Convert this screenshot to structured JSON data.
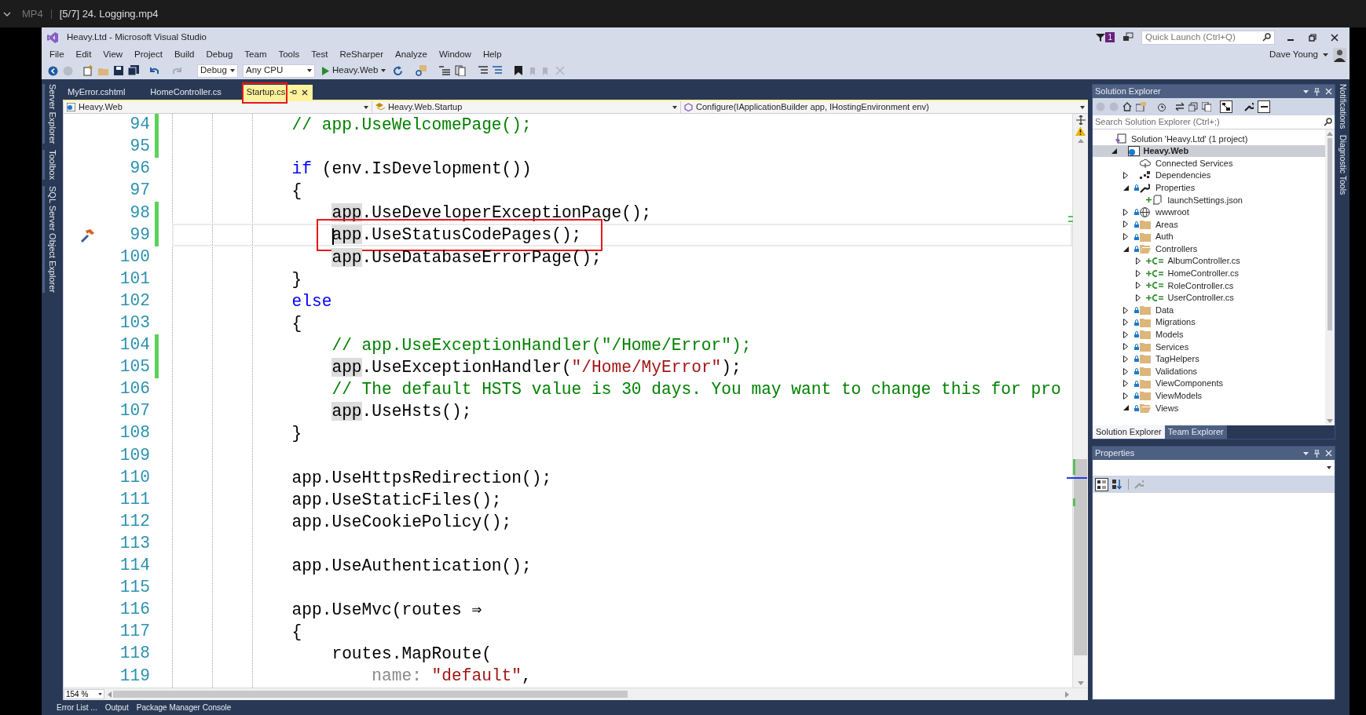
{
  "player": {
    "format": "MP4",
    "title": "[5/7] 24. Logging.mp4"
  },
  "window": {
    "title": "Heavy.Ltd - Microsoft Visual Studio",
    "notification_count": "1",
    "quick_launch_placeholder": "Quick Launch (Ctrl+Q)",
    "user": "Dave Young"
  },
  "menu": [
    "File",
    "Edit",
    "View",
    "Project",
    "Build",
    "Debug",
    "Team",
    "Tools",
    "Test",
    "ReSharper",
    "Analyze",
    "Window",
    "Help"
  ],
  "toolbar": {
    "configuration": "Debug",
    "platform": "Any CPU",
    "start": "Heavy.Web"
  },
  "left_tool_tabs": [
    "Server Explorer",
    "Toolbox",
    "SQL Server Object Explorer"
  ],
  "right_tool_tabs": [
    "Notifications",
    "Diagnostic Tools"
  ],
  "document_tabs": [
    {
      "label": "MyError.cshtml",
      "selected": false,
      "annotated": false
    },
    {
      "label": "HomeController.cs",
      "selected": false,
      "annotated": false
    },
    {
      "label": "Startup.cs",
      "selected": true,
      "annotated": true
    }
  ],
  "navigation": {
    "project": "Heavy.Web",
    "type": "Heavy.Web.Startup",
    "member": "Configure(IApplicationBuilder app, IHostingEnvironment env)"
  },
  "code_lines": [
    {
      "number": "94",
      "changed": true,
      "current": false,
      "annotated": false,
      "tokens": [
        {
          "kind": "comment",
          "text": "            // app.UseWelcomePage();"
        }
      ]
    },
    {
      "number": "95",
      "changed": true,
      "current": false,
      "annotated": false
    },
    {
      "number": "96",
      "changed": false,
      "current": false,
      "annotated": false,
      "tokens": [
        {
          "kind": "keyword",
          "text": "            if"
        },
        {
          "kind": "plain",
          "text": " (env.IsDevelopment())"
        }
      ]
    },
    {
      "number": "97",
      "changed": false,
      "current": false,
      "annotated": false,
      "tokens": [
        {
          "kind": "plain",
          "text": "            {"
        }
      ]
    },
    {
      "number": "98",
      "changed": true,
      "current": false,
      "annotated": false,
      "tokens": [
        {
          "kind": "reference",
          "text": "                app"
        },
        {
          "kind": "plain",
          "text": ".UseDeveloperExceptionPage();"
        }
      ]
    },
    {
      "number": "99",
      "changed": true,
      "current": true,
      "annotated": true,
      "tokens": [
        {
          "kind": "reference",
          "text": "                app"
        },
        {
          "kind": "plain",
          "text": ".UseStatusCodePages();"
        }
      ]
    },
    {
      "number": "100",
      "changed": false,
      "current": false,
      "annotated": false,
      "tokens": [
        {
          "kind": "reference",
          "text": "                app"
        },
        {
          "kind": "plain",
          "text": ".UseDatabaseErrorPage();"
        }
      ]
    },
    {
      "number": "101",
      "changed": false,
      "current": false,
      "annotated": false,
      "tokens": [
        {
          "kind": "plain",
          "text": "            }"
        }
      ]
    },
    {
      "number": "102",
      "changed": false,
      "current": false,
      "annotated": false,
      "tokens": [
        {
          "kind": "keyword",
          "text": "            else"
        }
      ]
    },
    {
      "number": "103",
      "changed": false,
      "current": false,
      "annotated": false,
      "tokens": [
        {
          "kind": "plain",
          "text": "            {"
        }
      ]
    },
    {
      "number": "104",
      "changed": true,
      "current": false,
      "annotated": false,
      "tokens": [
        {
          "kind": "comment",
          "text": "                // app.UseExceptionHandler(\"/Home/Error\");"
        }
      ]
    },
    {
      "number": "105",
      "changed": true,
      "current": false,
      "annotated": false,
      "tokens": [
        {
          "kind": "reference",
          "text": "                app"
        },
        {
          "kind": "plain",
          "text": ".UseExceptionHandler("
        },
        {
          "kind": "string",
          "text": "\"/Home/MyError\""
        },
        {
          "kind": "plain",
          "text": ");"
        }
      ]
    },
    {
      "number": "106",
      "changed": false,
      "current": false,
      "annotated": false,
      "tokens": [
        {
          "kind": "comment",
          "text": "                // The default HSTS value is 30 days. You may want to change this for pro"
        }
      ]
    },
    {
      "number": "107",
      "changed": false,
      "current": false,
      "annotated": false,
      "tokens": [
        {
          "kind": "reference",
          "text": "                app"
        },
        {
          "kind": "plain",
          "text": ".UseHsts();"
        }
      ]
    },
    {
      "number": "108",
      "changed": false,
      "current": false,
      "annotated": false,
      "tokens": [
        {
          "kind": "plain",
          "text": "            }"
        }
      ]
    },
    {
      "number": "109",
      "changed": false,
      "current": false,
      "annotated": false
    },
    {
      "number": "110",
      "changed": false,
      "current": false,
      "annotated": false,
      "tokens": [
        {
          "kind": "plain",
          "text": "            app.UseHttpsRedirection();"
        }
      ]
    },
    {
      "number": "111",
      "changed": false,
      "current": false,
      "annotated": false,
      "tokens": [
        {
          "kind": "plain",
          "text": "            app.UseStaticFiles();"
        }
      ]
    },
    {
      "number": "112",
      "changed": false,
      "current": false,
      "annotated": false,
      "tokens": [
        {
          "kind": "plain",
          "text": "            app.UseCookiePolicy();"
        }
      ]
    },
    {
      "number": "113",
      "changed": false,
      "current": false,
      "annotated": false
    },
    {
      "number": "114",
      "changed": false,
      "current": false,
      "annotated": false,
      "tokens": [
        {
          "kind": "plain",
          "text": "            app.UseAuthentication();"
        }
      ]
    },
    {
      "number": "115",
      "changed": false,
      "current": false,
      "annotated": false
    },
    {
      "number": "116",
      "changed": false,
      "current": false,
      "annotated": false,
      "tokens": [
        {
          "kind": "plain",
          "text": "            app.UseMvc(routes ⇒"
        }
      ]
    },
    {
      "number": "117",
      "changed": false,
      "current": false,
      "annotated": false,
      "tokens": [
        {
          "kind": "plain",
          "text": "            {"
        }
      ]
    },
    {
      "number": "118",
      "changed": false,
      "current": false,
      "annotated": false,
      "tokens": [
        {
          "kind": "plain",
          "text": "                routes.MapRoute("
        }
      ]
    },
    {
      "number": "119",
      "changed": false,
      "current": false,
      "annotated": false,
      "tokens": [
        {
          "kind": "hint",
          "text": "                    name:"
        },
        {
          "kind": "string",
          "text": " \"default\""
        },
        {
          "kind": "plain",
          "text": ","
        }
      ]
    }
  ],
  "zoom": "154 %",
  "solution_explorer": {
    "title": "Solution Explorer",
    "search_placeholder": "Search Solution Explorer (Ctrl+;)",
    "tree": [
      {
        "label": "Solution 'Heavy.Ltd' (1 project)",
        "kind": "solution",
        "locked": false,
        "added": false,
        "selected": false,
        "children": [
          {
            "label": "Heavy.Web",
            "kind": "project",
            "locked": false,
            "added": false,
            "selected": true,
            "expanded": true,
            "children": [
              {
                "label": "Connected Services",
                "kind": "cloud",
                "locked": false,
                "added": false,
                "selected": false
              },
              {
                "label": "Dependencies",
                "kind": "dependencies",
                "locked": false,
                "added": false,
                "selected": false,
                "expanded": false
              },
              {
                "label": "Properties",
                "kind": "properties",
                "locked": true,
                "added": false,
                "selected": false,
                "expanded": true,
                "children": [
                  {
                    "label": "launchSettings.json",
                    "kind": "json",
                    "locked": false,
                    "added": true,
                    "selected": false
                  }
                ]
              },
              {
                "label": "wwwroot",
                "kind": "globe",
                "locked": true,
                "added": false,
                "selected": false,
                "expanded": false
              },
              {
                "label": "Areas",
                "kind": "folder",
                "locked": true,
                "added": false,
                "selected": false,
                "expanded": false
              },
              {
                "label": "Auth",
                "kind": "folder",
                "locked": true,
                "added": false,
                "selected": false,
                "expanded": false
              },
              {
                "label": "Controllers",
                "kind": "folder",
                "locked": true,
                "added": false,
                "selected": false,
                "expanded": true,
                "children": [
                  {
                    "label": "AlbumController.cs",
                    "kind": "csharp",
                    "locked": false,
                    "added": true,
                    "selected": false,
                    "expanded": false
                  },
                  {
                    "label": "HomeController.cs",
                    "kind": "csharp",
                    "locked": false,
                    "added": true,
                    "selected": false,
                    "expanded": false
                  },
                  {
                    "label": "RoleController.cs",
                    "kind": "csharp",
                    "locked": false,
                    "added": true,
                    "selected": false,
                    "expanded": false
                  },
                  {
                    "label": "UserController.cs",
                    "kind": "csharp",
                    "locked": false,
                    "added": true,
                    "selected": false,
                    "expanded": false
                  }
                ]
              },
              {
                "label": "Data",
                "kind": "folder",
                "locked": true,
                "added": false,
                "selected": false,
                "expanded": false
              },
              {
                "label": "Migrations",
                "kind": "folder",
                "locked": true,
                "added": false,
                "selected": false,
                "expanded": false
              },
              {
                "label": "Models",
                "kind": "folder",
                "locked": true,
                "added": false,
                "selected": false,
                "expanded": false
              },
              {
                "label": "Services",
                "kind": "folder",
                "locked": true,
                "added": false,
                "selected": false,
                "expanded": false
              },
              {
                "label": "TagHelpers",
                "kind": "folder",
                "locked": true,
                "added": false,
                "selected": false,
                "expanded": false
              },
              {
                "label": "Validations",
                "kind": "folder",
                "locked": true,
                "added": false,
                "selected": false,
                "expanded": false
              },
              {
                "label": "ViewComponents",
                "kind": "folder",
                "locked": true,
                "added": false,
                "selected": false,
                "expanded": false
              },
              {
                "label": "ViewModels",
                "kind": "folder",
                "locked": true,
                "added": false,
                "selected": false,
                "expanded": false
              },
              {
                "label": "Views",
                "kind": "folder",
                "locked": true,
                "added": false,
                "selected": false,
                "expanded": true
              }
            ]
          }
        ]
      }
    ],
    "bottom_tabs": [
      {
        "label": "Solution Explorer",
        "selected": true
      },
      {
        "label": "Team Explorer",
        "selected": false
      }
    ]
  },
  "properties": {
    "title": "Properties"
  },
  "tool_windows": [
    "Error List ...",
    "Output",
    "Package Manager Console"
  ]
}
